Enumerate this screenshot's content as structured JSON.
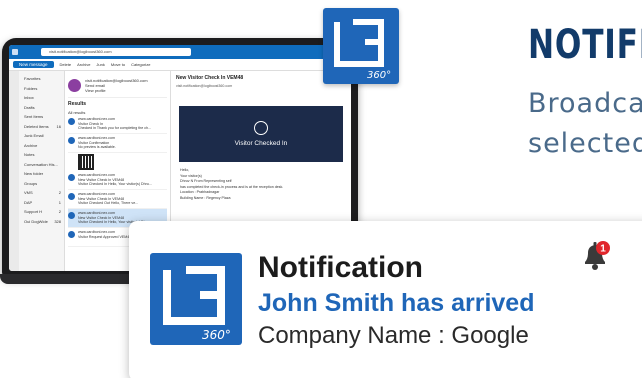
{
  "headline": "NOTIFI",
  "subtext": {
    "line1": "Broadca",
    "line2": "selected"
  },
  "logo": {
    "text": "LB",
    "sub": "360°"
  },
  "outlook": {
    "search_text": "visit.notification@logiboost360.com",
    "new_message": "New message",
    "ribbon": [
      "Delete",
      "Archive",
      "Junk",
      "Move to",
      "Categorize"
    ],
    "folders": [
      {
        "name": "Favorites",
        "count": ""
      },
      {
        "name": "Folders",
        "count": ""
      },
      {
        "name": "Inbox",
        "count": ""
      },
      {
        "name": "Drafts",
        "count": ""
      },
      {
        "name": "Sent Items",
        "count": ""
      },
      {
        "name": "Deleted Items",
        "count": "16"
      },
      {
        "name": "Junk Email",
        "count": ""
      },
      {
        "name": "Archive",
        "count": ""
      },
      {
        "name": "Notes",
        "count": ""
      },
      {
        "name": "Conversation His...",
        "count": ""
      },
      {
        "name": "New folder",
        "count": ""
      },
      {
        "name": "Groups",
        "count": ""
      },
      {
        "name": "VMS",
        "count": "2"
      },
      {
        "name": "DAP",
        "count": "1"
      },
      {
        "name": "Support H",
        "count": "2"
      },
      {
        "name": "Oui DogWide",
        "count": "328"
      }
    ],
    "profile": {
      "email": "visit.notification@logiboost360.com",
      "send_email": "Send email",
      "view_profile": "View profile"
    },
    "results_label": "Results",
    "all_results": "All results",
    "mails": [
      {
        "from": "www.cardboni.nex.com",
        "subject": "Visitor Check In",
        "preview": "Checked in Thank you for completing the ch...",
        "time": "Thu 14:21"
      },
      {
        "from": "www.cardboni.nex.com",
        "subject": "Visitor Confirmation",
        "preview": "No preview is available.",
        "time": "Thu 14:13"
      },
      {
        "from": "www.cardboni.nex.com",
        "subject": "New Visitor Check In VEM48",
        "preview": "Visitor Checked In Hello, Your visitor(s) Dhru...",
        "time": "7/13/2023"
      },
      {
        "from": "www.cardboni.nex.com",
        "subject": "New Visitor Check In VEM48",
        "preview": "Visitor Checked Out Hello, There ve...",
        "time": "7/13/2023"
      },
      {
        "from": "www.cardboni.nex.com",
        "subject": "New Visitor Check In VEM48",
        "preview": "Visitor Checked In Hello, Your visitor(s) Dhru...",
        "time": "7/12/2023"
      },
      {
        "from": "www.cardboni.nex.com",
        "subject": "Visitor Request Approved VEM48",
        "preview": "",
        "time": "7/12/2023"
      }
    ],
    "reading": {
      "subject": "New Visitor Check In VEM48",
      "from": "visit.notification@logiboost360.com",
      "banner": "Visitor Checked In",
      "body": [
        "Hello,",
        "Your visitor(s)",
        "Dhruv N From Representing self",
        "has completed the check-in process and is at the reception desk.",
        "Location : Prabhadnagar",
        "Building Name : Regency Plaza"
      ]
    }
  },
  "notification": {
    "title": "Notification",
    "line2": "John Smith has arrived",
    "line3": "Company Name : Google",
    "badge": "1"
  },
  "colors": {
    "brand_blue": "#1f66b8",
    "headline": "#123b6a",
    "outlook_blue": "#0f6cbd",
    "badge_red": "#e0262b"
  }
}
